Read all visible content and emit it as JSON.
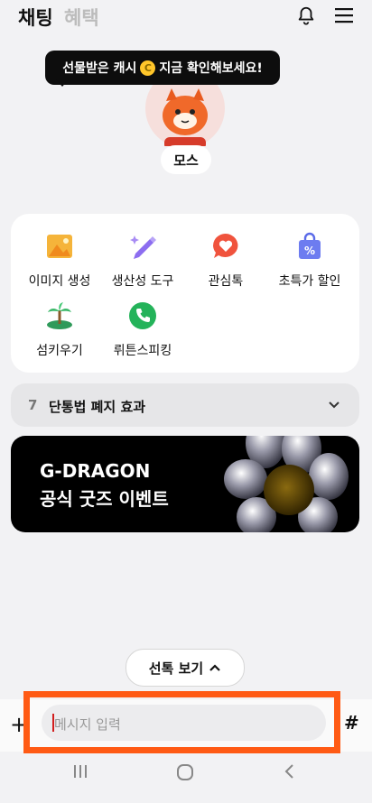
{
  "header": {
    "tab_chat": "채팅",
    "tab_benefits": "혜택",
    "icons": [
      "bell-icon",
      "menu-icon"
    ]
  },
  "tooltip": {
    "text_before": "선물받은 캐시",
    "coin_symbol": "C",
    "text_after": "지금 확인해보세요!"
  },
  "profile": {
    "name": "모스"
  },
  "features": [
    {
      "label": "이미지 생성",
      "icon": "image-icon"
    },
    {
      "label": "생산성 도구",
      "icon": "pencil-sparkle-icon"
    },
    {
      "label": "관심톡",
      "icon": "heart-bubble-icon"
    },
    {
      "label": "초특가 할인",
      "icon": "discount-bag-icon"
    },
    {
      "label": "섬키우기",
      "icon": "island-icon"
    },
    {
      "label": "뤼튼스피킹",
      "icon": "phone-icon"
    }
  ],
  "notice": {
    "number": "7",
    "text": "단통법 폐지 효과"
  },
  "banner": {
    "line1": "G-DRAGON",
    "line2": "공식 굿즈 이벤트"
  },
  "selected_talk": {
    "label": "선톡 보기"
  },
  "composer": {
    "plus": "+",
    "placeholder": "메시지 입력",
    "hash": "#"
  },
  "colors": {
    "highlight": "#ff5a14",
    "tooltip_bg": "#0d0d0d",
    "coin": "#ffc62a"
  }
}
